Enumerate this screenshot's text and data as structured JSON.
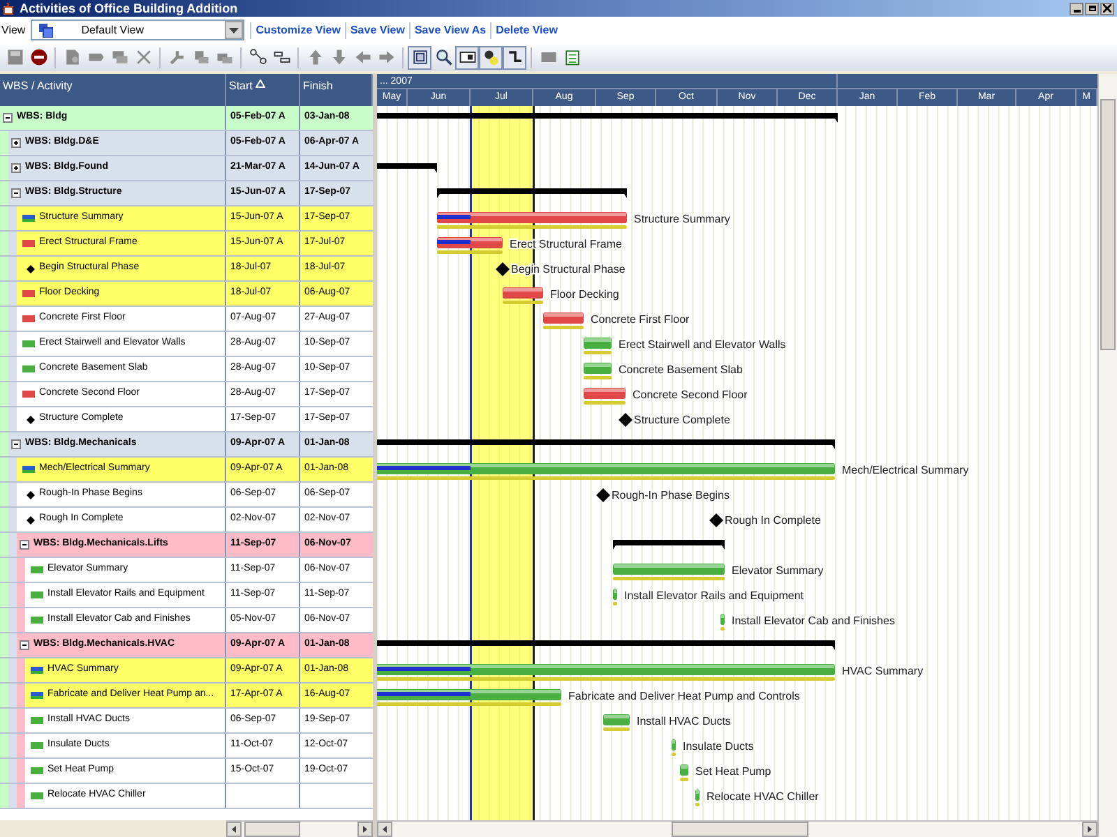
{
  "window": {
    "title": "Activities of Office Building Addition"
  },
  "view_bar": {
    "label": "View",
    "selected_view": "Default View",
    "links": [
      "Customize View",
      "Save View",
      "Save View As",
      "Delete View"
    ]
  },
  "table": {
    "columns": [
      "WBS / Activity",
      "Start",
      "Finish"
    ]
  },
  "timescale": {
    "year": "... 2007",
    "months": [
      "May",
      "Jun",
      "Jul",
      "Aug",
      "Sep",
      "Oct",
      "Nov",
      "Dec",
      "Jan",
      "Feb",
      "Mar",
      "Apr",
      "M"
    ]
  },
  "wbs": [
    {
      "kind": "wbs",
      "name": "WBS: Bldg",
      "start": "05-Feb-07 A",
      "finish": "03-Jan-08",
      "expanded": true,
      "children": [
        {
          "kind": "wbs",
          "name": "WBS: Bldg.D&E",
          "start": "05-Feb-07 A",
          "finish": "06-Apr-07 A",
          "expanded": false
        },
        {
          "kind": "wbs",
          "name": "WBS: Bldg.Found",
          "start": "21-Mar-07 A",
          "finish": "14-Jun-07 A",
          "expanded": false
        },
        {
          "kind": "wbs",
          "name": "WBS: Bldg.Structure",
          "start": "15-Jun-07 A",
          "finish": "17-Sep-07",
          "expanded": true,
          "children": [
            {
              "kind": "summary",
              "name": "Structure Summary",
              "start": "15-Jun-07 A",
              "finish": "17-Sep-07",
              "highlighted": true,
              "started": true,
              "color": "#e04848",
              "bar_label": "Structure Summary"
            },
            {
              "kind": "task",
              "name": "Erect Structural Frame",
              "start": "15-Jun-07 A",
              "finish": "17-Jul-07",
              "highlighted": true,
              "started": true,
              "color": "#e04848",
              "bar_label": "Erect Structural Frame"
            },
            {
              "kind": "milestone",
              "name": "Begin Structural Phase",
              "start": "18-Jul-07",
              "finish": "18-Jul-07",
              "highlighted": true,
              "bar_label": "Begin Structural Phase"
            },
            {
              "kind": "task",
              "name": "Floor Decking",
              "start": "18-Jul-07",
              "finish": "06-Aug-07",
              "highlighted": true,
              "started": false,
              "color": "#e04848",
              "bar_label": "Floor Decking"
            },
            {
              "kind": "task",
              "name": "Concrete First Floor",
              "start": "07-Aug-07",
              "finish": "27-Aug-07",
              "highlighted": false,
              "started": false,
              "color": "#e04848",
              "bar_label": "Concrete First Floor"
            },
            {
              "kind": "task",
              "name": "Erect Stairwell and Elevator Walls",
              "start": "28-Aug-07",
              "finish": "10-Sep-07",
              "highlighted": false,
              "started": false,
              "color": "#48b040",
              "bar_label": "Erect Stairwell and Elevator Walls"
            },
            {
              "kind": "task",
              "name": "Concrete Basement Slab",
              "start": "28-Aug-07",
              "finish": "10-Sep-07",
              "highlighted": false,
              "started": false,
              "color": "#48b040",
              "bar_label": "Concrete Basement Slab"
            },
            {
              "kind": "task",
              "name": "Concrete Second Floor",
              "start": "28-Aug-07",
              "finish": "17-Sep-07",
              "highlighted": false,
              "started": false,
              "color": "#e04848",
              "bar_label": "Concrete Second Floor"
            },
            {
              "kind": "milestone",
              "name": "Structure Complete",
              "start": "17-Sep-07",
              "finish": "17-Sep-07",
              "highlighted": false,
              "bar_label": "Structure Complete"
            }
          ]
        },
        {
          "kind": "wbs",
          "name": "WBS: Bldg.Mechanicals",
          "start": "09-Apr-07 A",
          "finish": "01-Jan-08",
          "expanded": true,
          "children": [
            {
              "kind": "summary",
              "name": "Mech/Electrical Summary",
              "start": "09-Apr-07 A",
              "finish": "01-Jan-08",
              "highlighted": true,
              "started": true,
              "color": "#48b040",
              "bar_label": "Mech/Electrical Summary"
            },
            {
              "kind": "milestone",
              "name": "Rough-In Phase Begins",
              "start": "06-Sep-07",
              "finish": "06-Sep-07",
              "highlighted": false,
              "bar_label": "Rough-In Phase Begins"
            },
            {
              "kind": "milestone",
              "name": "Rough In Complete",
              "start": "02-Nov-07",
              "finish": "02-Nov-07",
              "highlighted": false,
              "bar_label": "Rough In Complete"
            },
            {
              "kind": "wbs",
              "name": "WBS: Bldg.Mechanicals.Lifts",
              "start": "11-Sep-07",
              "finish": "06-Nov-07",
              "expanded": true,
              "children": [
                {
                  "kind": "task",
                  "name": "Elevator Summary",
                  "start": "11-Sep-07",
                  "finish": "06-Nov-07",
                  "highlighted": false,
                  "started": false,
                  "color": "#48b040",
                  "bar_label": "Elevator Summary"
                },
                {
                  "kind": "task",
                  "name": "Install Elevator Rails and Equipment",
                  "start": "11-Sep-07",
                  "finish": "11-Sep-07",
                  "highlighted": false,
                  "started": false,
                  "color": "#48b040",
                  "bar_label": "Install Elevator Rails and Equipment"
                },
                {
                  "kind": "task",
                  "name": "Install Elevator Cab and Finishes",
                  "start": "05-Nov-07",
                  "finish": "06-Nov-07",
                  "highlighted": false,
                  "started": false,
                  "color": "#48b040",
                  "bar_label": "Install Elevator Cab and Finishes"
                }
              ]
            },
            {
              "kind": "wbs",
              "name": "WBS: Bldg.Mechanicals.HVAC",
              "start": "09-Apr-07 A",
              "finish": "01-Jan-08",
              "expanded": true,
              "children": [
                {
                  "kind": "summary",
                  "name": "HVAC Summary",
                  "start": "09-Apr-07 A",
                  "finish": "01-Jan-08",
                  "highlighted": true,
                  "started": true,
                  "color": "#48b040",
                  "bar_label": "HVAC Summary"
                },
                {
                  "kind": "summary",
                  "name": "Fabricate and Deliver Heat Pump an...",
                  "start": "17-Apr-07 A",
                  "finish": "16-Aug-07",
                  "highlighted": true,
                  "started": true,
                  "color": "#48b040",
                  "bar_label": "Fabricate and Deliver Heat Pump and Controls"
                },
                {
                  "kind": "task",
                  "name": "Install HVAC Ducts",
                  "start": "06-Sep-07",
                  "finish": "19-Sep-07",
                  "highlighted": false,
                  "started": false,
                  "color": "#48b040",
                  "bar_label": "Install HVAC Ducts"
                },
                {
                  "kind": "task",
                  "name": "Insulate Ducts",
                  "start": "11-Oct-07",
                  "finish": "12-Oct-07",
                  "highlighted": false,
                  "started": false,
                  "color": "#48b040",
                  "bar_label": "Insulate Ducts"
                },
                {
                  "kind": "task",
                  "name": "Set Heat Pump",
                  "start": "15-Oct-07",
                  "finish": "19-Oct-07",
                  "highlighted": false,
                  "started": false,
                  "color": "#48b040",
                  "bar_label": "Set Heat Pump"
                },
                {
                  "kind": "task",
                  "name": "Relocate HVAC Chiller",
                  "highlighted": false,
                  "started": false,
                  "color": "#48b040",
                  "bar_label": "Relocate HVAC Chiller"
                }
              ]
            }
          ]
        }
      ]
    }
  ]
}
